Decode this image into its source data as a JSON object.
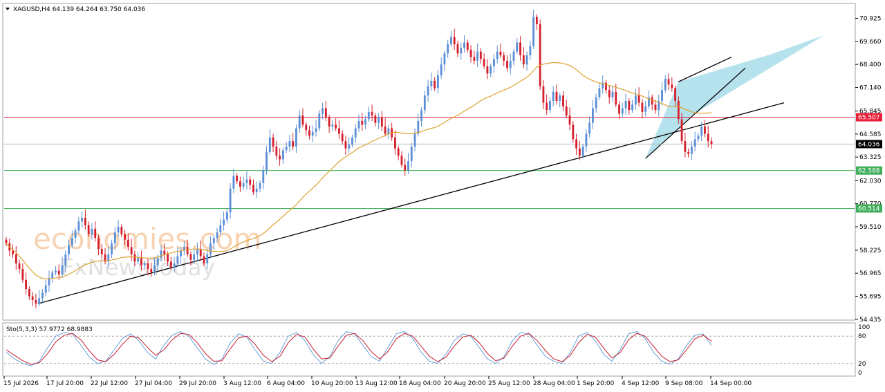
{
  "header": {
    "menu_icon": "triangle-down-icon",
    "symbol_info": "XAGUSD,H4  64.139 64.264 63.750 64.036"
  },
  "oscillator": {
    "label": "Sto(5,3,3) 57.9772 68.9883",
    "levels": [
      100,
      80,
      20,
      0
    ]
  },
  "watermark": {
    "line1": "economies.com",
    "line2": "FxNewsToday"
  },
  "chart_data": [
    {
      "type": "candlestick",
      "symbol": "XAGUSD",
      "timeframe": "H4",
      "title": "XAGUSD,H4  64.139 64.264 63.750 64.036",
      "ohlc_last": {
        "open": 64.139,
        "high": 64.264,
        "low": 63.75,
        "close": 64.036
      },
      "ylim": [
        54.435,
        71.7
      ],
      "y_ticks": [
        "70.925",
        "69.660",
        "68.400",
        "67.140",
        "65.845",
        "64.585",
        "63.325",
        "62.030",
        "60.770",
        "59.510",
        "58.225",
        "56.965",
        "55.695",
        "54.435"
      ],
      "x_ticks": [
        "15 Jul 2026",
        "17 Jul 20:00",
        "22 Jul 12:00",
        "27 Jul 04:00",
        "29 Jul 20:00",
        "3 Aug 12:00",
        "6 Aug 04:00",
        "10 Aug 20:00",
        "13 Aug 12:00",
        "18 Aug 04:00",
        "20 Aug 20:00",
        "25 Aug 12:00",
        "28 Aug 04:00",
        "1 Sep 20:00",
        "4 Sep 12:00",
        "9 Sep 08:00",
        "14 Sep 00:00"
      ],
      "closes": [
        58.6,
        58.2,
        58.0,
        57.5,
        57.2,
        56.6,
        56.1,
        55.7,
        55.5,
        55.3,
        55.6,
        55.9,
        56.3,
        56.7,
        57.0,
        57.1,
        56.9,
        57.4,
        58.0,
        58.5,
        58.9,
        59.3,
        59.8,
        60.0,
        59.6,
        59.1,
        59.4,
        58.9,
        58.3,
        58.0,
        57.6,
        58.0,
        58.6,
        59.2,
        59.5,
        59.1,
        58.8,
        58.4,
        58.0,
        57.6,
        57.8,
        57.4,
        57.5,
        57.2,
        57.0,
        57.4,
        57.8,
        58.2,
        58.0,
        57.6,
        57.3,
        57.5,
        57.9,
        58.2,
        58.4,
        58.0,
        57.7,
        58.0,
        58.3,
        57.9,
        57.5,
        58.0,
        58.6,
        58.9,
        59.2,
        59.6,
        59.9,
        60.3,
        61.6,
        62.3,
        62.0,
        61.7,
        61.9,
        62.1,
        61.8,
        61.4,
        61.6,
        61.9,
        62.6,
        63.6,
        64.4,
        63.9,
        63.4,
        63.2,
        63.7,
        63.9,
        64.2,
        63.9,
        64.9,
        65.6,
        65.1,
        64.8,
        64.5,
        64.7,
        64.9,
        65.7,
        66.0,
        65.5,
        65.0,
        65.1,
        64.9,
        64.6,
        64.2,
        63.8,
        64.0,
        64.4,
        64.9,
        65.3,
        65.1,
        65.4,
        65.8,
        65.6,
        65.2,
        65.5,
        65.0,
        64.6,
        64.9,
        64.4,
        63.8,
        63.4,
        62.9,
        62.6,
        63.1,
        63.9,
        64.6,
        65.3,
        65.9,
        66.7,
        67.2,
        67.5,
        67.1,
        67.8,
        68.4,
        69.0,
        69.5,
        69.9,
        69.5,
        69.0,
        69.3,
        69.6,
        69.2,
        68.8,
        68.6,
        69.1,
        68.7,
        68.3,
        67.9,
        68.3,
        68.7,
        69.1,
        68.9,
        68.6,
        68.2,
        68.6,
        69.1,
        69.6,
        68.9,
        68.4,
        68.9,
        69.4,
        71.0,
        70.6,
        67.2,
        66.3,
        65.9,
        66.4,
        66.9,
        66.4,
        66.7,
        66.1,
        65.6,
        65.1,
        64.3,
        63.8,
        63.4,
        63.9,
        64.6,
        65.2,
        66.0,
        66.6,
        67.1,
        67.4,
        67.0,
        66.6,
        66.9,
        66.2,
        65.7,
        66.0,
        66.4,
        65.9,
        66.2,
        66.7,
        66.3,
        65.8,
        66.1,
        66.6,
        66.2,
        65.9,
        66.4,
        67.0,
        67.6,
        67.3,
        67.1,
        66.4,
        65.4,
        64.2,
        63.6,
        63.5,
        63.9,
        64.3,
        64.5,
        65.0,
        64.6,
        64.2,
        64.036
      ],
      "ma_period_label": "",
      "horizontal_levels": [
        {
          "value": 65.507,
          "label": "65.507",
          "color": "#e8213a"
        },
        {
          "value": 64.036,
          "label": "64.036",
          "color": "#000000"
        },
        {
          "value": 62.588,
          "label": "62.588",
          "color": "#3fae5a"
        },
        {
          "value": 60.514,
          "label": "60.514",
          "color": "#3fae5a"
        }
      ],
      "colors": {
        "bull": "#5b8fd6",
        "bear": "#d61f2c",
        "ma": "#e0a030",
        "channel_fill": "#a8dde9"
      }
    },
    {
      "type": "line",
      "title": "Sto(5,3,3) 57.9772 68.9883",
      "ylim": [
        0,
        100
      ],
      "levels": [
        20,
        80
      ],
      "series": [
        {
          "name": "",
          "color": "#6aa0dc",
          "values": [
            45,
            30,
            20,
            15,
            25,
            55,
            80,
            88,
            85,
            60,
            35,
            20,
            25,
            50,
            75,
            85,
            70,
            45,
            30,
            60,
            82,
            90,
            80,
            55,
            30,
            18,
            30,
            65,
            85,
            78,
            50,
            25,
            20,
            45,
            80,
            88,
            70,
            40,
            20,
            35,
            70,
            90,
            85,
            60,
            35,
            25,
            55,
            85,
            90,
            75,
            45,
            25,
            20,
            40,
            70,
            85,
            80,
            55,
            30,
            20,
            35,
            70,
            88,
            85,
            60,
            35,
            25,
            20,
            45,
            80,
            88,
            70,
            40,
            25,
            50,
            85,
            90,
            75,
            45,
            25,
            18,
            30,
            60,
            82,
            85,
            60
          ]
        },
        {
          "name": "",
          "color": "#c81d2e",
          "values": [
            50,
            38,
            26,
            18,
            22,
            42,
            68,
            82,
            86,
            72,
            48,
            28,
            24,
            40,
            62,
            80,
            76,
            56,
            38,
            50,
            72,
            86,
            84,
            66,
            42,
            25,
            26,
            52,
            76,
            80,
            62,
            38,
            24,
            36,
            66,
            84,
            78,
            52,
            30,
            32,
            58,
            82,
            86,
            70,
            46,
            30,
            46,
            74,
            86,
            80,
            58,
            36,
            24,
            34,
            58,
            78,
            82,
            66,
            42,
            26,
            32,
            58,
            80,
            86,
            70,
            48,
            30,
            24,
            38,
            66,
            84,
            78,
            54,
            32,
            44,
            72,
            86,
            80,
            58,
            36,
            24,
            28,
            50,
            74,
            82,
            69
          ]
        }
      ]
    }
  ]
}
